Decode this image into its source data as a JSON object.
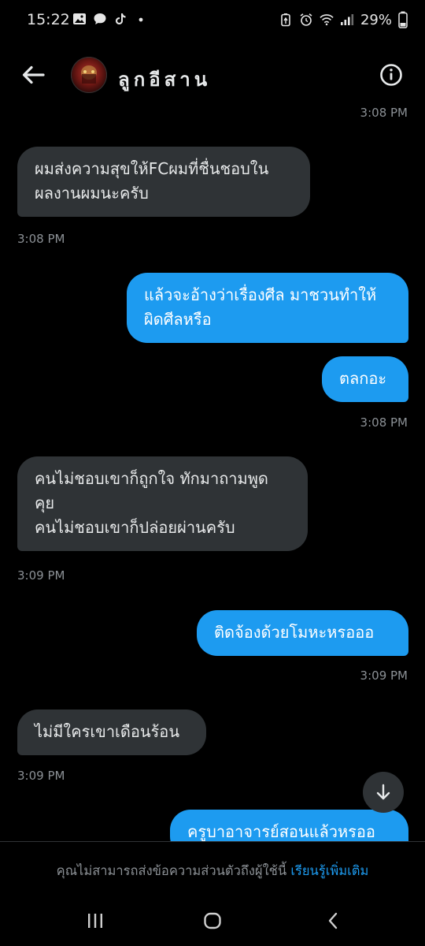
{
  "status_bar": {
    "time": "15:22",
    "battery": "29%",
    "left_icons": [
      "gallery-icon",
      "chat-bubble-icon",
      "tiktok-icon",
      "dot-icon"
    ],
    "right_icons": [
      "battery-saver-icon",
      "alarm-icon",
      "wifi-icon",
      "signal-icon",
      "battery-icon"
    ]
  },
  "header": {
    "contact_name": "ลูกอีสาน",
    "back_icon": "arrow-left-icon",
    "info_icon": "info-circle-icon"
  },
  "messages": [
    {
      "type": "timestamp",
      "text": "3:08 PM",
      "align": "right"
    },
    {
      "type": "incoming",
      "lines": [
        "ผมส่งความสุขให้FCผมที่ชื่นชอบใน",
        "ผลงานผมนะครับ"
      ]
    },
    {
      "type": "timestamp",
      "text": "3:08 PM",
      "align": "left"
    },
    {
      "type": "outgoing",
      "lines": [
        "แล้วจะอ้างว่าเรื่องศีล มาชวนทำให้",
        "ผิดศีลหรือ"
      ]
    },
    {
      "type": "outgoing",
      "lines": [
        "ตลกอะ"
      ]
    },
    {
      "type": "timestamp",
      "text": "3:08 PM",
      "align": "right"
    },
    {
      "type": "incoming",
      "lines": [
        "คนไม่ชอบเขาก็ถูกใจ ทักมาถามพูด",
        "คุย",
        "คนไม่ชอบเขาก็ปล่อยผ่านครับ"
      ]
    },
    {
      "type": "timestamp",
      "text": "3:09 PM",
      "align": "left"
    },
    {
      "type": "outgoing",
      "lines": [
        "ติดจ้องด้วยโมหะหรอออ"
      ]
    },
    {
      "type": "timestamp",
      "text": "3:09 PM",
      "align": "right"
    },
    {
      "type": "incoming",
      "lines": [
        "ไม่มีใครเขาเดือนร้อน"
      ]
    },
    {
      "type": "timestamp",
      "text": "3:09 PM",
      "align": "left"
    },
    {
      "type": "outgoing",
      "lines": [
        "ครูบาอาจารย์สอนแล้วหรออ"
      ]
    }
  ],
  "scroll_down_icon": "arrow-down-icon",
  "footer": {
    "notice": "คุณไม่สามารถส่งข้อความส่วนตัวถึงผู้ใช้นี้",
    "learn_more": "เรียนรู้เพิ่มเติม"
  },
  "navbar": {
    "recent_icon": "recent-apps-icon",
    "home_icon": "home-icon",
    "back_icon": "nav-back-icon"
  },
  "colors": {
    "background": "#000000",
    "incoming_bubble": "#2f3336",
    "outgoing_bubble": "#1d9bf0",
    "timestamp": "#8b9095",
    "link": "#1d9bf0"
  }
}
